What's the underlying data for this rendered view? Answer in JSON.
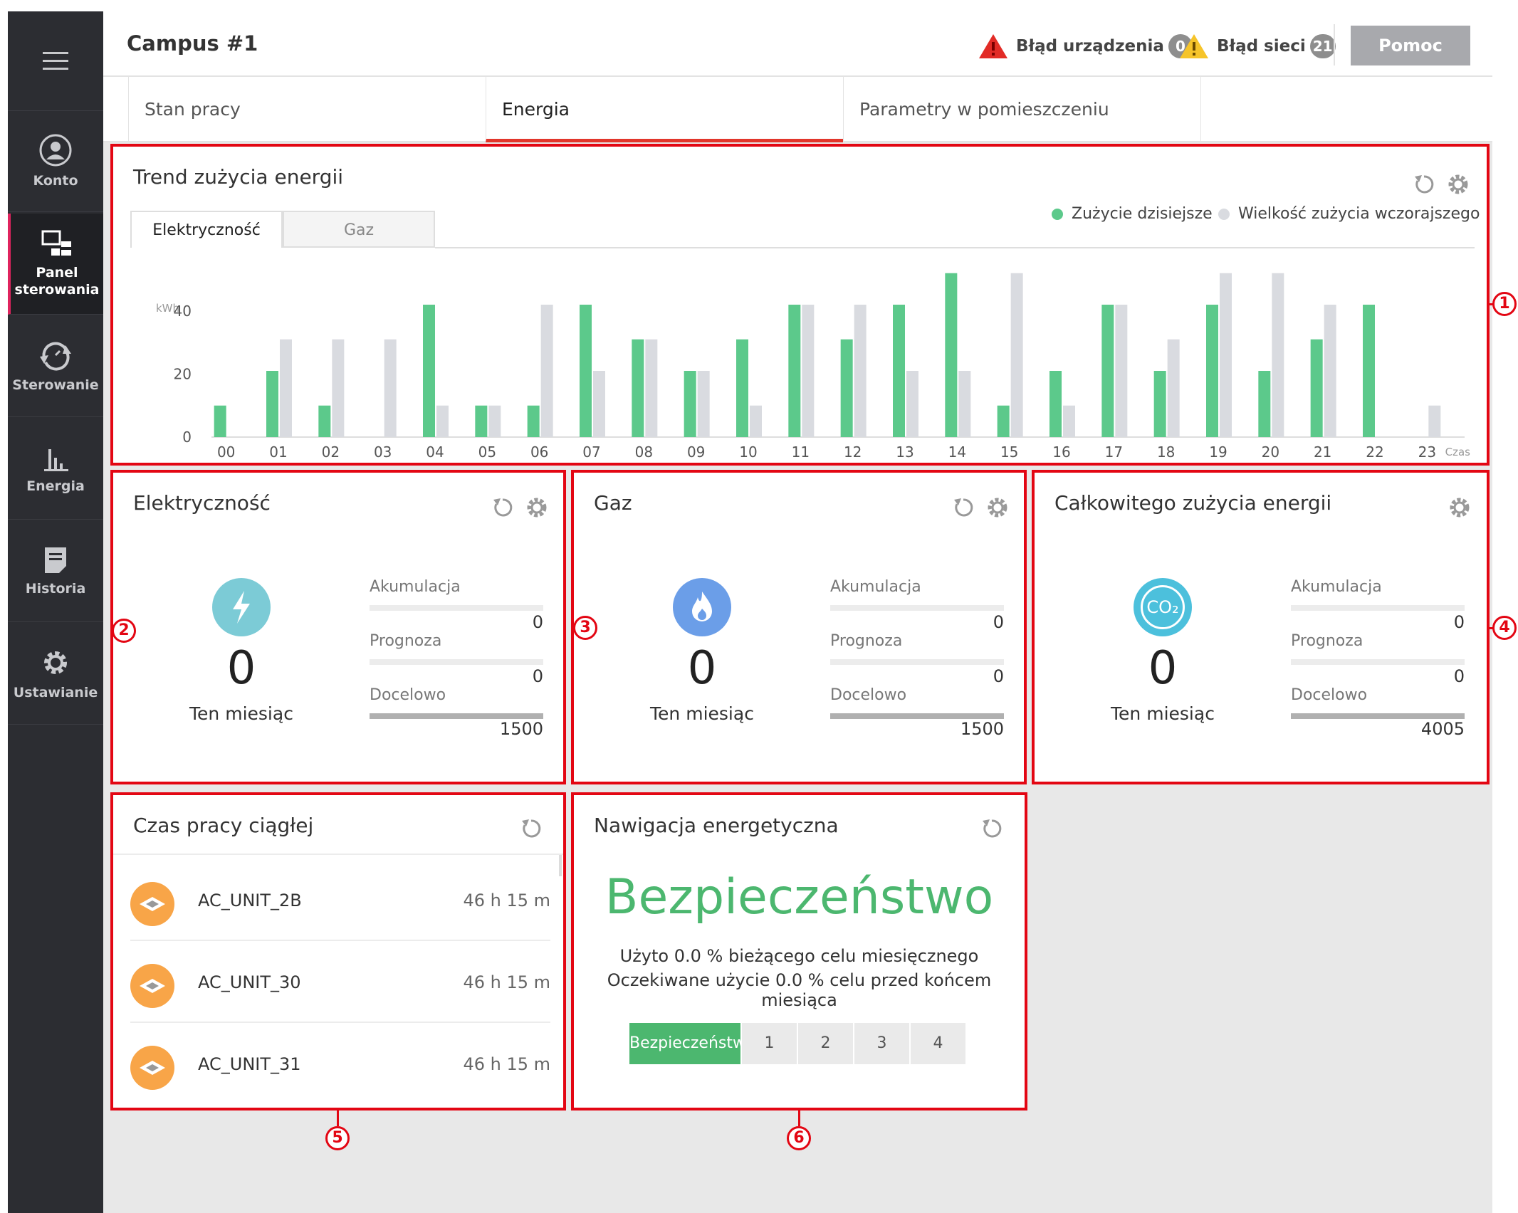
{
  "sidebar": {
    "items": [
      {
        "label": "Konto",
        "icon": "account-icon"
      },
      {
        "label": "Panel sterowania",
        "icon": "dashboard-icon",
        "active": true
      },
      {
        "label": "Sterowanie",
        "icon": "control-icon"
      },
      {
        "label": "Energia",
        "icon": "energy-chart-icon"
      },
      {
        "label": "Historia",
        "icon": "history-icon"
      },
      {
        "label": "Ustawianie",
        "icon": "gear-icon"
      }
    ]
  },
  "header": {
    "title": "Campus #1",
    "device_error_label": "Błąd urządzenia",
    "device_error_count": "0",
    "network_error_label": "Błąd sieci",
    "network_error_count": "21",
    "help_label": "Pomoc"
  },
  "tabs": [
    {
      "label": "Stan pracy"
    },
    {
      "label": "Energia",
      "active": true
    },
    {
      "label": "Parametry w pomieszczeniu"
    }
  ],
  "trend": {
    "title": "Trend zużycia energii",
    "subtabs": [
      "Elektryczność",
      "Gaz"
    ],
    "legend_today": "Zużycie dzisiejsze",
    "legend_yesterday": "Wielkość zużycia wczorajszego",
    "unit": "kWh",
    "time_label": "Czas",
    "colors": {
      "today": "#5cc98b",
      "yesterday": "#d9dbe0"
    }
  },
  "chart_data": {
    "type": "bar",
    "categories": [
      "00",
      "01",
      "02",
      "03",
      "04",
      "05",
      "06",
      "07",
      "08",
      "09",
      "10",
      "11",
      "12",
      "13",
      "14",
      "15",
      "16",
      "17",
      "18",
      "19",
      "20",
      "21",
      "22",
      "23"
    ],
    "series": [
      {
        "name": "Zużycie dzisiejsze",
        "values": [
          10,
          21,
          10,
          0,
          42,
          10,
          10,
          42,
          31,
          21,
          31,
          42,
          31,
          42,
          52,
          10,
          21,
          42,
          21,
          42,
          21,
          31,
          42,
          0
        ]
      },
      {
        "name": "Wielkość zużycia wczorajszego",
        "values": [
          0,
          31,
          31,
          31,
          10,
          10,
          42,
          21,
          31,
          21,
          10,
          42,
          42,
          21,
          21,
          52,
          10,
          42,
          31,
          52,
          52,
          42,
          0,
          10
        ]
      }
    ],
    "y_ticks": [
      "0",
      "20",
      "40"
    ],
    "ylim": [
      0,
      56
    ],
    "ylabel": "kWh",
    "xlabel": "Czas",
    "legend_position": "top-right"
  },
  "electricity": {
    "title": "Elektryczność",
    "value": "0",
    "period": "Ten miesiąc",
    "accumulation_label": "Akumulacja",
    "accumulation_value": "0",
    "forecast_label": "Prognoza",
    "forecast_value": "0",
    "target_label": "Docelowo",
    "target_value": "1500",
    "icon_color": "#7ccbd6"
  },
  "gas": {
    "title": "Gaz",
    "value": "0",
    "period": "Ten miesiąc",
    "accumulation_label": "Akumulacja",
    "accumulation_value": "0",
    "forecast_label": "Prognoza",
    "forecast_value": "0",
    "target_label": "Docelowo",
    "target_value": "1500",
    "icon_color": "#6b9ee8"
  },
  "total": {
    "title": "Całkowitego zużycia energii",
    "value": "0",
    "period": "Ten miesiąc",
    "accumulation_label": "Akumulacja",
    "accumulation_value": "0",
    "forecast_label": "Prognoza",
    "forecast_value": "0",
    "target_label": "Docelowo",
    "target_value": "4005",
    "icon_color": "#4cc0dc",
    "icon_text": "CO₂"
  },
  "continuous": {
    "title": "Czas pracy ciągłej",
    "items": [
      {
        "name": "AC_UNIT_2B",
        "time": "46 h 15 m"
      },
      {
        "name": "AC_UNIT_30",
        "time": "46 h 15 m"
      },
      {
        "name": "AC_UNIT_31",
        "time": "46 h 15 m"
      }
    ]
  },
  "navigation": {
    "title": "Nawigacja energetyczna",
    "status": "Bezpieczeństwo",
    "line1": "Użyto 0.0 % bieżącego celu miesięcznego",
    "line2": "Oczekiwane użycie 0.0 % celu przed końcem miesiąca",
    "segments": [
      "Bezpieczeństwo",
      "1",
      "2",
      "3",
      "4"
    ]
  },
  "callouts": [
    "1",
    "2",
    "3",
    "4",
    "5",
    "6"
  ]
}
